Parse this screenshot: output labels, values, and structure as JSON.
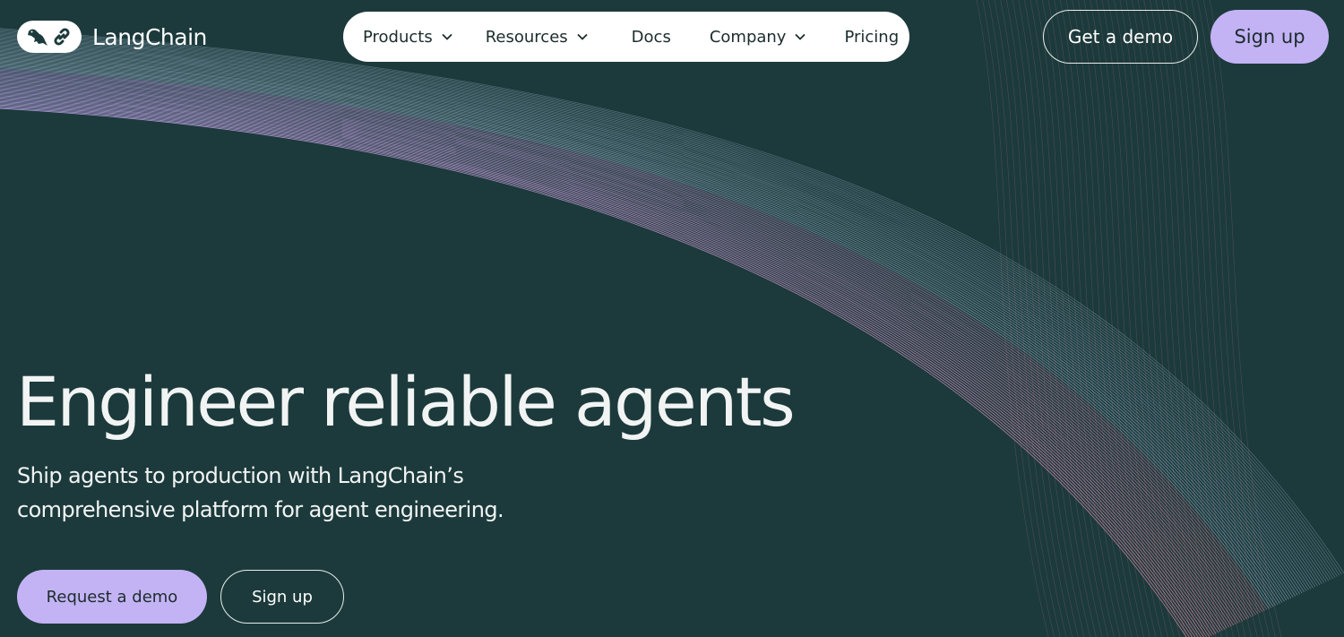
{
  "brand": {
    "name": "LangChain",
    "logo_icons": [
      "parrot-icon",
      "chain-link-icon"
    ]
  },
  "nav": {
    "items": [
      {
        "label": "Products",
        "has_dropdown": true
      },
      {
        "label": "Resources",
        "has_dropdown": true
      },
      {
        "label": "Docs",
        "has_dropdown": false
      },
      {
        "label": "Company",
        "has_dropdown": true
      },
      {
        "label": "Pricing",
        "has_dropdown": false
      }
    ]
  },
  "header": {
    "get_demo_label": "Get a demo",
    "sign_up_label": "Sign up"
  },
  "hero": {
    "title": "Engineer reliable agents",
    "subtitle_line1": "Ship agents to production with LangChain’s",
    "subtitle_line2": "comprehensive platform for agent engineering.",
    "primary_cta": "Request a demo",
    "secondary_cta": "Sign up"
  },
  "colors": {
    "background": "#1c3a3b",
    "accent_lavender": "#c3b3f5",
    "wave_purple": "#b79ad8",
    "wave_pink": "#d9849c",
    "wave_blue": "#a8c2dc"
  }
}
